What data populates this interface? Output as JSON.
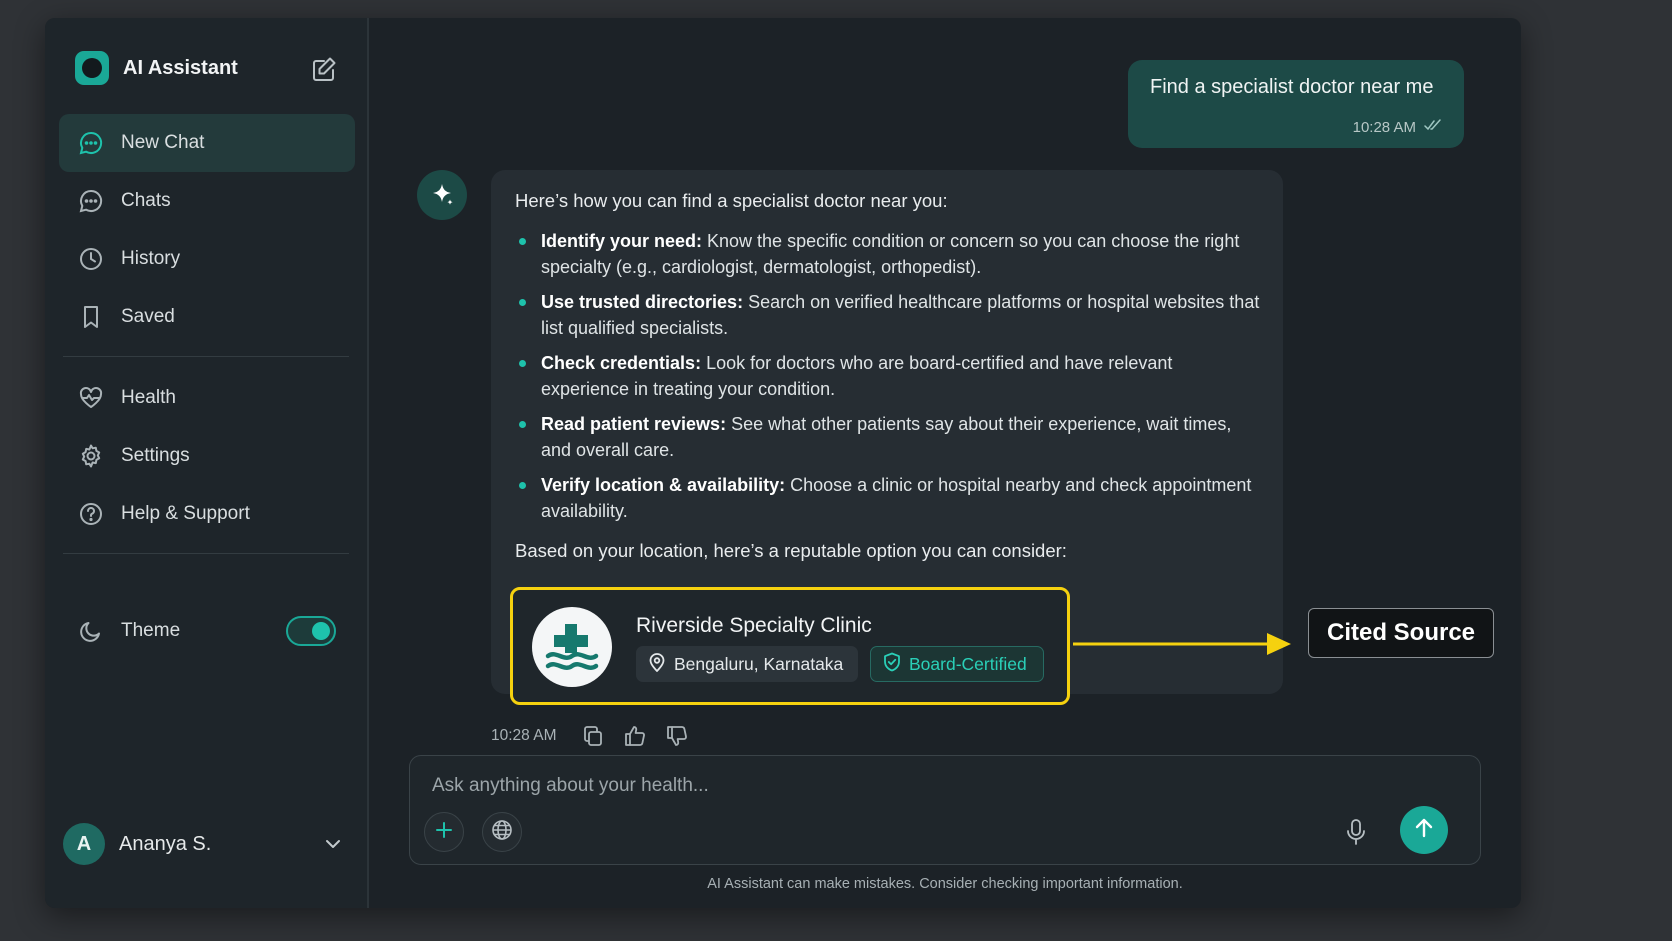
{
  "sidebar": {
    "brand": "AI Assistant",
    "items": [
      {
        "label": "New Chat",
        "icon": "chat-bubble-icon",
        "active": true
      },
      {
        "label": "Chats",
        "icon": "chat-bubble-icon"
      },
      {
        "label": "History",
        "icon": "clock-icon"
      },
      {
        "label": "Saved",
        "icon": "bookmark-icon"
      },
      {
        "label": "Health",
        "icon": "heart-pulse-icon"
      },
      {
        "label": "Settings",
        "icon": "gear-icon"
      },
      {
        "label": "Help & Support",
        "icon": "help-circle-icon"
      }
    ],
    "theme": {
      "label": "Theme",
      "enabled": true
    },
    "user": {
      "initial": "A",
      "name": "Ananya S."
    }
  },
  "chat": {
    "user_message": {
      "text": "Find a specialist doctor near me",
      "time": "10:28 AM"
    },
    "ai_message": {
      "intro": "Here’s how you can find a specialist doctor near you:",
      "bullets": [
        {
          "title": "Identify your need:",
          "text": " Know the specific condition or concern so you can choose the right specialty (e.g., cardiologist, dermatologist, orthopedist)."
        },
        {
          "title": "Use trusted directories:",
          "text": " Search on verified healthcare platforms or hospital websites that list qualified specialists."
        },
        {
          "title": "Check credentials:",
          "text": " Look for doctors who are board-certified and have relevant experience in treating your condition."
        },
        {
          "title": "Read patient reviews:",
          "text": " See what other patients say about their experience, wait times, and overall care."
        },
        {
          "title": "Verify location & availability:",
          "text": " Choose a clinic or hospital nearby and check appointment availability."
        }
      ],
      "outro": "Based on your location, here’s a reputable option you can consider:",
      "clinic": {
        "name": "Riverside Specialty Clinic",
        "location": "Bengaluru, Karnataka",
        "badge": "Board-Certified"
      },
      "time": "10:28 AM"
    },
    "annotation": "Cited Source"
  },
  "composer": {
    "placeholder": "Ask anything about your health...",
    "disclaimer": "AI Assistant can make mistakes. Consider checking important information."
  },
  "colors": {
    "accent": "#1aa897",
    "highlight": "#f5d10f",
    "background": "#1c2227"
  }
}
